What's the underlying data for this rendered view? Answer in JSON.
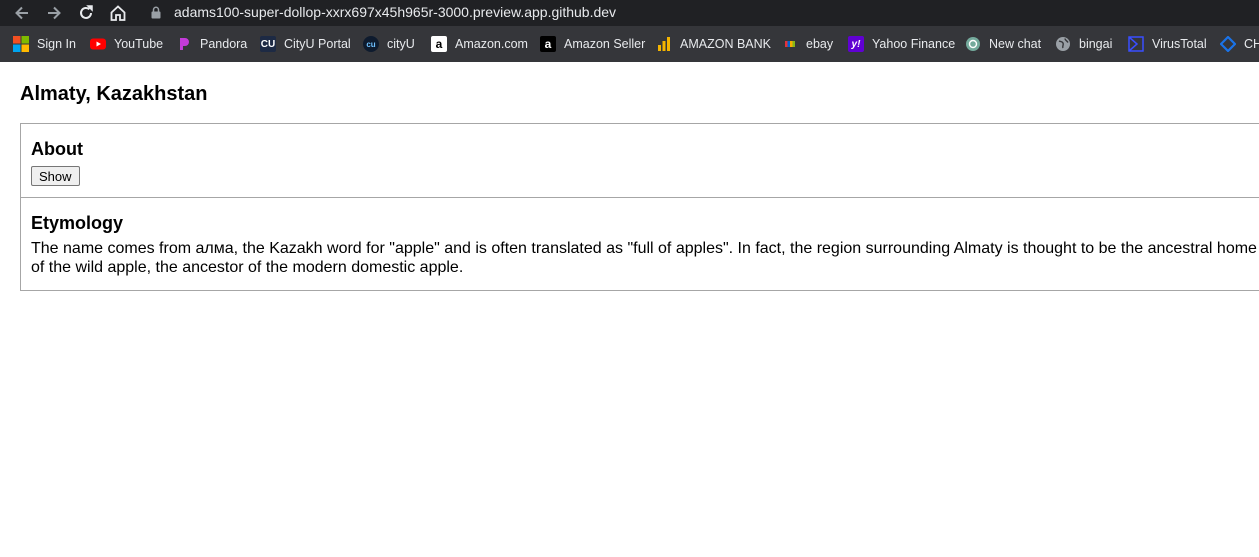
{
  "browser": {
    "url": "adams100-super-dollop-xxrx697x45h965r-3000.preview.app.github.dev",
    "bookmarks": [
      {
        "label": "Sign In",
        "icon": "microsoft-icon"
      },
      {
        "label": "YouTube",
        "icon": "youtube-icon"
      },
      {
        "label": "Pandora",
        "icon": "pandora-icon"
      },
      {
        "label": "CityU Portal",
        "icon": "cityu-icon"
      },
      {
        "label": "cityU",
        "icon": "cityu-icon"
      },
      {
        "label": "Amazon.com",
        "icon": "amazon-icon"
      },
      {
        "label": "Amazon Seller",
        "icon": "amazon-icon"
      },
      {
        "label": "AMAZON BANK",
        "icon": "bank-chart-icon"
      },
      {
        "label": "ebay",
        "icon": "ebay-icon"
      },
      {
        "label": "Yahoo Finance",
        "icon": "yahoo-icon"
      },
      {
        "label": "New chat",
        "icon": "openai-icon"
      },
      {
        "label": "bingai",
        "icon": "globe-icon"
      },
      {
        "label": "VirusTotal",
        "icon": "virustotal-icon"
      },
      {
        "label": "CH",
        "icon": "blue-logo-icon"
      }
    ]
  },
  "page": {
    "title": "Almaty, Kazakhstan",
    "about": {
      "heading": "About",
      "button_label": "Show"
    },
    "etymology": {
      "heading": "Etymology",
      "text": "The name comes from алма, the Kazakh word for \"apple\" and is often translated as \"full of apples\". In fact, the region surrounding Almaty is thought to be the ancestral home of the wild apple, the ancestor of the modern domestic apple."
    }
  },
  "colors": {
    "chrome_dark": "#202124",
    "bookmarks_bar": "#35363a",
    "card_border": "#a6a6a6"
  }
}
